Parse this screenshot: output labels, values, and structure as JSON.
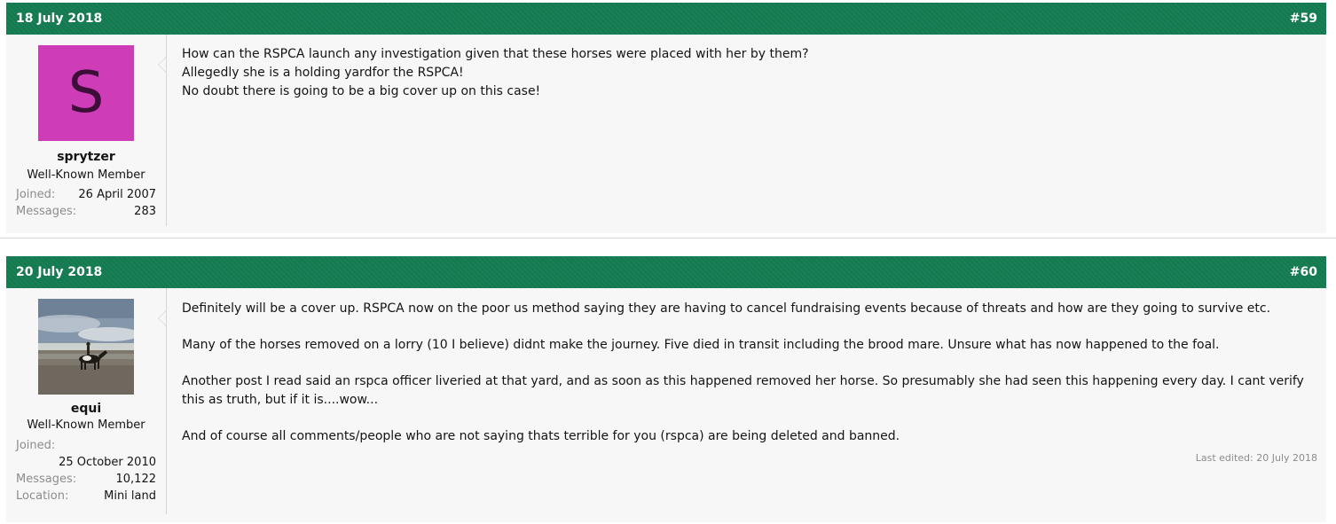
{
  "posts": [
    {
      "date": "18 July 2018",
      "number": "#59",
      "user": {
        "avatar_letter": "S",
        "avatar_color": "#cf3cb7",
        "username": "sprytzer",
        "title": "Well-Known Member",
        "joined_label": "Joined:",
        "joined_value": "26 April 2007",
        "messages_label": "Messages:",
        "messages_value": "283"
      },
      "body": [
        "How can the RSPCA launch any investigation given that these horses were placed with her by them?",
        "Allegedly she is a holding yardfor the RSPCA!",
        "No doubt there is going to be a big cover up on this case!"
      ]
    },
    {
      "date": "20 July 2018",
      "number": "#60",
      "user": {
        "avatar_image": "beach-rider-photo",
        "username": "equi",
        "title": "Well-Known Member",
        "joined_label": "Joined:",
        "joined_value": "25 October 2010",
        "messages_label": "Messages:",
        "messages_value": "10,122",
        "location_label": "Location:",
        "location_value": "Mini land"
      },
      "body": [
        "Definitely will be a cover up. RSPCA now on the poor us method saying they are having to cancel fundraising events because of threats and how are they going to survive etc.",
        "Many of the horses removed on a lorry (10 I believe) didnt make the journey. Five died in transit including the brood mare. Unsure what has now happened to the foal.",
        "Another post I read said an rspca officer liveried at that yard, and as soon as this happened removed her horse. So presumably she had seen this happening every day. I cant verify this as truth, but if it is....wow...",
        "And of course all comments/people who are not saying thats terrible for you (rspca) are being deleted and banned."
      ],
      "last_edited": "Last edited: 20 July 2018"
    }
  ],
  "colors": {
    "header_green": "#147a50",
    "post_background": "#f7f7f7",
    "muted_text": "#8c8c8c"
  }
}
